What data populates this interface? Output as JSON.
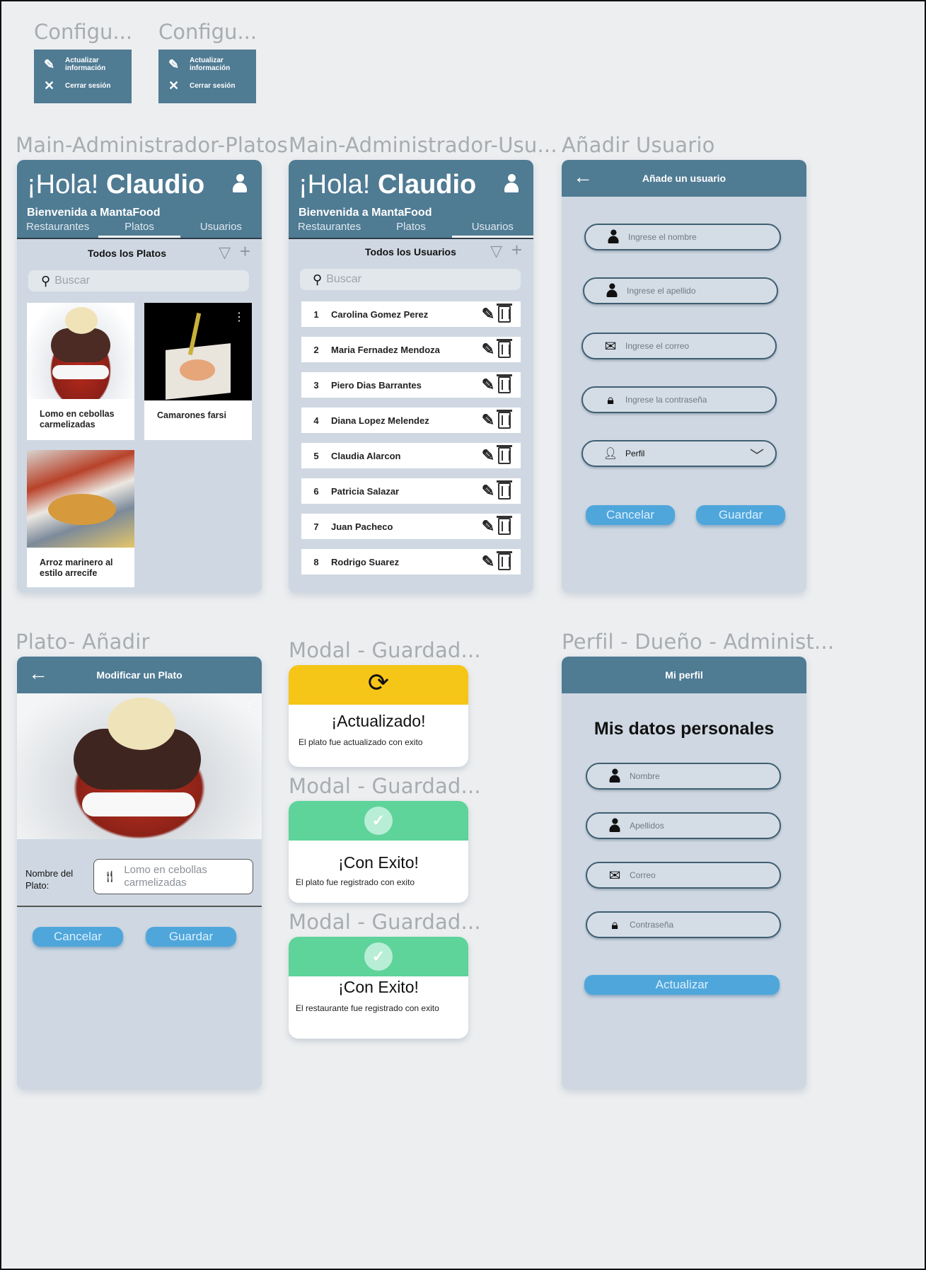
{
  "config_menus": [
    {
      "label": "Configu...",
      "items": [
        {
          "icon": "pencil-icon",
          "text": "Actualizar información"
        },
        {
          "icon": "close-icon",
          "text": "Cerrar sesión"
        }
      ]
    },
    {
      "label": "Configu...",
      "items": [
        {
          "icon": "pencil-icon",
          "text": "Actualizar información"
        },
        {
          "icon": "close-icon",
          "text": "Cerrar sesión"
        }
      ]
    }
  ],
  "frames": {
    "platos": "Main-Administrador-Platos",
    "usuarios": "Main-Administrador-Usu...",
    "add_user": "Añadir Usuario",
    "plato_add": "Plato- Añadir",
    "modal1": "Modal - Guardad...",
    "modal2": "Modal - Guardad...",
    "modal3": "Modal - Guardad...",
    "perfil": "Perfil - Dueño - Administ..."
  },
  "main_header": {
    "greeting": "¡Hola!",
    "name": "Claudio",
    "welcome": "Bienvenida a MantaFood",
    "tabs": [
      "Restaurantes",
      "Platos",
      "Usuarios"
    ]
  },
  "platos_screen": {
    "section_title": "Todos los Platos",
    "search_placeholder": "Buscar",
    "dishes": [
      "Lomo en cebollas carmelizadas",
      "Camarones farsi",
      "Arroz marinero al estilo arrecife"
    ]
  },
  "usuarios_screen": {
    "section_title": "Todos los Usuarios",
    "search_placeholder": "Buscar",
    "users": [
      {
        "num": "1",
        "name": "Carolina Gomez Perez"
      },
      {
        "num": "2",
        "name": "Maria Fernadez Mendoza"
      },
      {
        "num": "3",
        "name": "Piero Dias Barrantes"
      },
      {
        "num": "4",
        "name": "Diana Lopez Melendez"
      },
      {
        "num": "5",
        "name": "Claudia Alarcon"
      },
      {
        "num": "6",
        "name": "Patricia Salazar"
      },
      {
        "num": "7",
        "name": "Juan Pacheco"
      },
      {
        "num": "8",
        "name": "Rodrigo Suarez"
      }
    ]
  },
  "add_user_screen": {
    "title": "Añade un usuario",
    "fields": [
      "Ingrese el nombre",
      "Ingrese el apellido",
      "Ingrese el correo",
      "Ingrese la contraseña"
    ],
    "profile_select": "Perfil",
    "cancel": "Cancelar",
    "save": "Guardar"
  },
  "plato_add_screen": {
    "title": "Modificar un Plato",
    "field_label": "Nombre del Plato:",
    "field_value": "Lomo en cebollas carmelizadas",
    "cancel": "Cancelar",
    "save": "Guardar"
  },
  "modals": [
    {
      "title": "¡Actualizado!",
      "message": "El plato fue actualizado con exito",
      "color": "#f5c518"
    },
    {
      "title": "¡Con Exito!",
      "message": "El plato fue registrado con exito",
      "color": "#5ed39a"
    },
    {
      "title": "¡Con Exito!",
      "message": "El restaurante fue registrado con exito",
      "color": "#5ed39a"
    }
  ],
  "perfil_screen": {
    "title": "Mi perfil",
    "heading": "Mis datos personales",
    "fields": [
      "Nombre",
      "Apellidos",
      "Correo",
      "Contraseña"
    ],
    "update": "Actualizar"
  },
  "colors": {
    "header": "#4f7b93",
    "button": "#4ea6db",
    "screen_bg": "#cfd8e2"
  }
}
